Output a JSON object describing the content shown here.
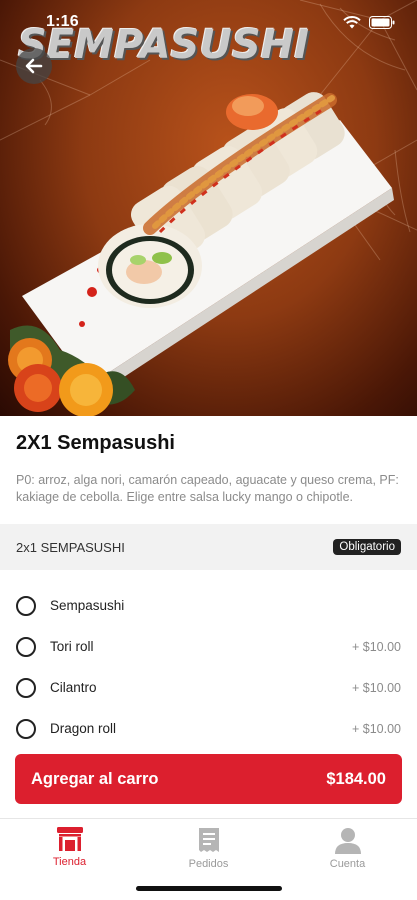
{
  "status_bar": {
    "time": "1:16"
  },
  "hero": {
    "brand_title": "SEMPASUSHI"
  },
  "product": {
    "title": "2X1 Sempasushi",
    "description": "P0: arroz, alga nori, camarón capeado, aguacate y queso crema, PF: kakiage de cebolla. Elige entre salsa lucky mango o chipotle."
  },
  "section": {
    "title": "2x1 SEMPASUSHI",
    "badge": "Obligatorio"
  },
  "options": [
    {
      "label": "Sempasushi",
      "price": ""
    },
    {
      "label": "Tori roll",
      "price": "+ $10.00"
    },
    {
      "label": "Cilantro",
      "price": "+ $10.00"
    },
    {
      "label": "Dragon roll",
      "price": "+ $10.00"
    }
  ],
  "cart": {
    "label": "Agregar al carro",
    "price": "$184.00"
  },
  "tabs": [
    {
      "label": "Tienda",
      "icon": "store-icon",
      "active": true
    },
    {
      "label": "Pedidos",
      "icon": "receipt-icon",
      "active": false
    },
    {
      "label": "Cuenta",
      "icon": "user-icon",
      "active": false
    }
  ],
  "colors": {
    "accent": "#dc1f2e",
    "hero_bg": "#8d3a12",
    "muted_text": "#8b8b8b"
  }
}
